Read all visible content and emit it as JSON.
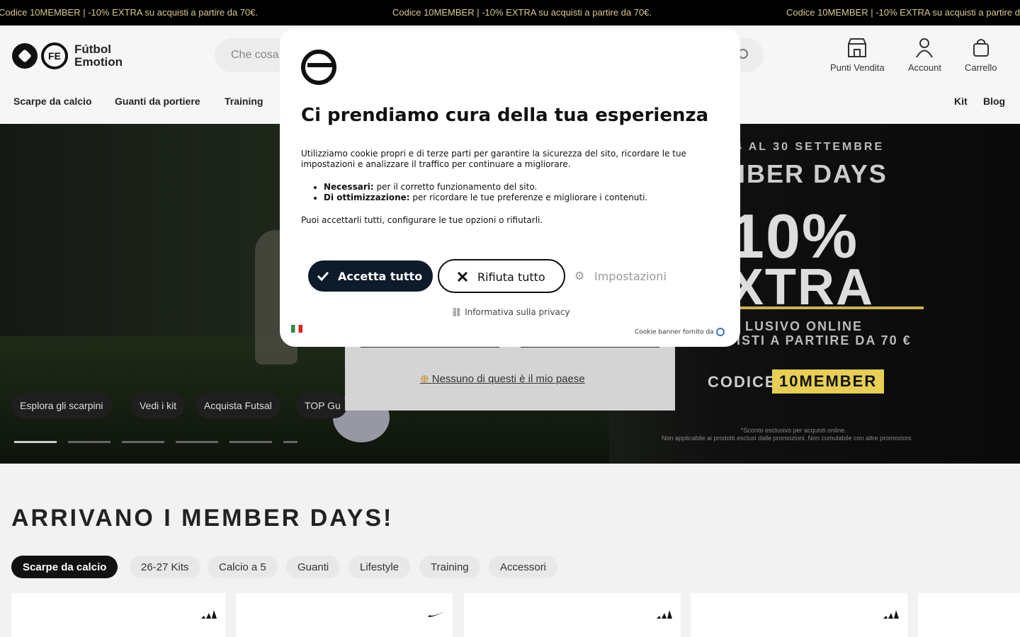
{
  "topbar": {
    "text": "Codice 10MEMBER | -10% EXTRA su acquisti a partire da 70€."
  },
  "header": {
    "logo_line1": "Fútbol",
    "logo_line2": "Emotion",
    "logo_mark": "FE",
    "search_placeholder": "Che cosa",
    "stores": "Punti Vendita",
    "account": "Account",
    "cart": "Carrello"
  },
  "nav": {
    "items": [
      "Scarpe da calcio",
      "Guanti da portiere",
      "Training",
      "Kit",
      "Blog"
    ]
  },
  "hero": {
    "date": "4 AL 30 SETTEMBRE",
    "title": "MBER DAYS",
    "pct": "10%",
    "extra": "XTRA",
    "excl1": "LUSIVO ONLINE",
    "excl2": "ISTI A PARTIRE DA 70 €",
    "code_label": "CODICE:",
    "code": "10MEMBER",
    "note1": "*Sconto esclusivo per acquisti online.",
    "note2": "Non applicabile ai prodotti esclusi dalle promozioni. Non cumulabile con altre promozioni.",
    "buttons": [
      "Esplora gli scarpini",
      "Vedi i kit",
      "Acquista Futsal",
      "TOP Gu"
    ]
  },
  "country": {
    "none": "Nessuno di questi è il mio paese"
  },
  "cookie": {
    "title": "Ci prendiamo cura della tua esperienza",
    "intro": "Utilizziamo cookie propri e di terze parti per garantire la sicurezza del sito, ricordare le tue impostazioni e analizzare il traffico per continuare a migliorare.",
    "nec_label": "Necessari:",
    "nec_text": " per il corretto funzionamento del sito.",
    "opt_label": "Di ottimizzazione:",
    "opt_text": " per ricordare le tue preferenze e migliorare i contenuti.",
    "outro": "Puoi accettarli tutti, configurare le tue opzioni o rifiutarli.",
    "accept": "Accetta tutto",
    "reject": "Rifiuta tutto",
    "settings": "Impostazioni",
    "privacy": "Informativa sulla privacy",
    "powered": "Cookie banner fornito da"
  },
  "section": {
    "title": "ARRIVANO I MEMBER DAYS!",
    "chips": [
      "Scarpe da calcio",
      "26-27 Kits",
      "Calcio a 5",
      "Guanti",
      "Lifestyle",
      "Training",
      "Accessori"
    ]
  }
}
